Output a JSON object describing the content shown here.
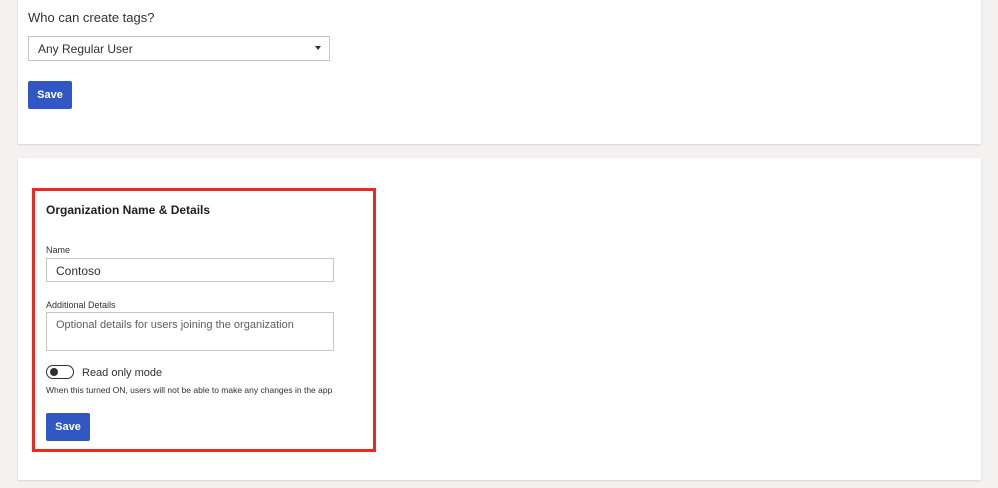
{
  "tags_section": {
    "question_label": "Who can create tags?",
    "select_value": "Any Regular User",
    "save_label": "Save"
  },
  "org_section": {
    "title": "Organization Name & Details",
    "name_label": "Name",
    "name_value": "Contoso",
    "details_label": "Additional Details",
    "details_placeholder": "Optional details for users joining the organization",
    "read_only_label": "Read only mode",
    "read_only_state": "off",
    "read_only_help": "When this turned ON, users will not be able to make any changes in the app",
    "save_label": "Save"
  },
  "colors": {
    "primary_button": "#3157c4",
    "highlight_border": "#ea2a1e",
    "page_background": "#f3f2f1",
    "card_background": "#ffffff"
  }
}
